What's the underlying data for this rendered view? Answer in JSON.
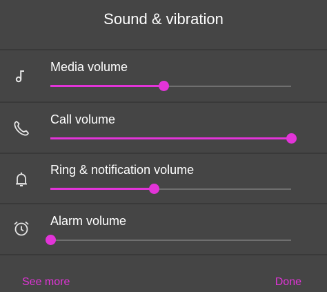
{
  "dialog": {
    "title": "Sound & vibration",
    "accent_color": "#e234d8",
    "background_color": "#454545"
  },
  "volumes": [
    {
      "label": "Media volume",
      "icon": "music-note-icon",
      "level": 0.47
    },
    {
      "label": "Call volume",
      "icon": "phone-icon",
      "level": 1.0
    },
    {
      "label": "Ring & notification volume",
      "icon": "bell-icon",
      "level": 0.43
    },
    {
      "label": "Alarm volume",
      "icon": "alarm-clock-icon",
      "level": 0.0
    }
  ],
  "footer": {
    "see_more": "See more",
    "done": "Done"
  }
}
